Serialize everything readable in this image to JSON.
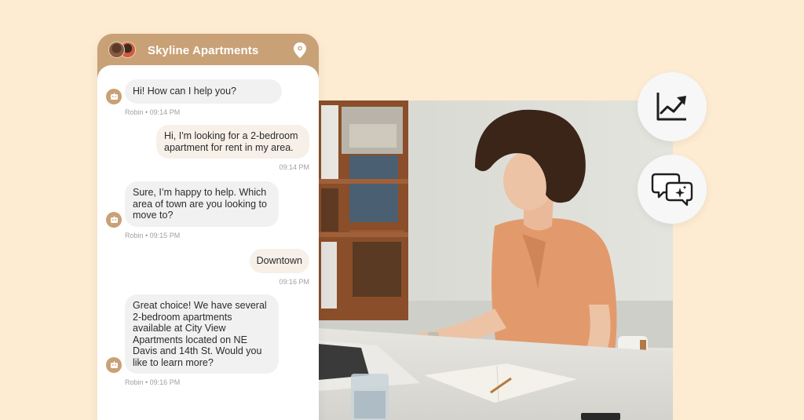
{
  "chat": {
    "title": "Skyline Apartments",
    "header_icon": "location-pin-icon",
    "avatars": [
      "agent-avatar-1",
      "agent-avatar-2"
    ],
    "messages": [
      {
        "sender": "bot",
        "text": "Hi! How can I help you?",
        "meta": "Robin • 09:14 PM"
      },
      {
        "sender": "user",
        "text": "Hi, I'm looking for a 2-bedroom apartment for rent in my area.",
        "meta": "09:14 PM"
      },
      {
        "sender": "bot",
        "text": "Sure, I’m happy to help. Which area of town are you looking to move to?",
        "meta": "Robin • 09:15 PM"
      },
      {
        "sender": "user",
        "text": "Downtown",
        "meta": "09:16 PM"
      },
      {
        "sender": "bot",
        "text": "Great choice! We have several 2-bedroom apartments available at City View Apartments located on NE Davis and 14th St. Would you like to learn more?",
        "meta": "Robin • 09:16 PM"
      }
    ]
  },
  "floating_icons": [
    {
      "name": "trending-chart-icon"
    },
    {
      "name": "ai-chat-bubbles-icon"
    }
  ],
  "photo": {
    "description": "Woman with curly hair in orange top typing on a laptop at a desk"
  },
  "colors": {
    "background": "#fdebd2",
    "accent": "#c9a176",
    "bot_bubble": "#f1f1f1",
    "user_bubble": "#f6f0e9"
  }
}
